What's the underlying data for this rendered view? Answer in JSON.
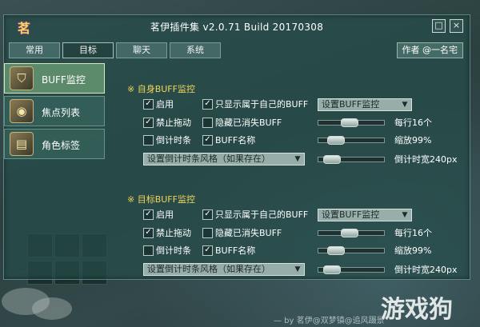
{
  "window": {
    "title": "茗伊插件集 v2.0.71 Build 20170308",
    "logo": "茗",
    "maximize_icon": "□",
    "close_icon": "×"
  },
  "tabs": [
    "常用",
    "目标",
    "聊天",
    "系统"
  ],
  "active_tab_index": 1,
  "author_button": "作者 @一名宅",
  "sidebar": {
    "items": [
      {
        "label": "BUFF监控",
        "icon": "shield-helmet-icon",
        "glyph": "⛉",
        "active": true
      },
      {
        "label": "焦点列表",
        "icon": "eye-scroll-icon",
        "glyph": "◉",
        "active": false
      },
      {
        "label": "角色标签",
        "icon": "book-icon",
        "glyph": "▤",
        "active": false
      }
    ]
  },
  "sections": [
    {
      "title": "※ 自身BUFF监控",
      "enable": {
        "label": "启用",
        "checked": true
      },
      "only_own_buff": {
        "label": "只显示属于自己的BUFF",
        "checked": true
      },
      "setup_dropdown": "设置BUFF监控",
      "disable_drag": {
        "label": "禁止拖动",
        "checked": true
      },
      "hide_expired": {
        "label": "隐藏已消失BUFF",
        "checked": false
      },
      "per_row": {
        "text": "每行16个",
        "value": 0.45
      },
      "countdown_bar": {
        "label": "倒计时条",
        "checked": false
      },
      "buff_name": {
        "label": "BUFF名称",
        "checked": true
      },
      "scale": {
        "text": "缩放99%",
        "value": 0.18
      },
      "bar_style_dropdown": "设置倒计时条风格（如果存在）",
      "bar_width": {
        "text": "倒计时宽240px",
        "value": 0.1
      }
    },
    {
      "title": "※ 目标BUFF监控",
      "enable": {
        "label": "启用",
        "checked": true
      },
      "only_own_buff": {
        "label": "只显示属于自己的BUFF",
        "checked": true
      },
      "setup_dropdown": "设置BUFF监控",
      "disable_drag": {
        "label": "禁止拖动",
        "checked": true
      },
      "hide_expired": {
        "label": "隐藏已消失BUFF",
        "checked": false
      },
      "per_row": {
        "text": "每行16个",
        "value": 0.45
      },
      "countdown_bar": {
        "label": "倒计时条",
        "checked": false
      },
      "buff_name": {
        "label": "BUFF名称",
        "checked": true
      },
      "scale": {
        "text": "缩放99%",
        "value": 0.18
      },
      "bar_style_dropdown": "设置倒计时条风格（如果存在）",
      "bar_width": {
        "text": "倒计时宽240px",
        "value": 0.1
      }
    }
  ],
  "check_glyph": "✓",
  "dropdown_arrow": "▼",
  "backdrop": {
    "watermark": "游戏狗",
    "credit": "— by 茗伊@双梦镇@追风蹑景"
  }
}
